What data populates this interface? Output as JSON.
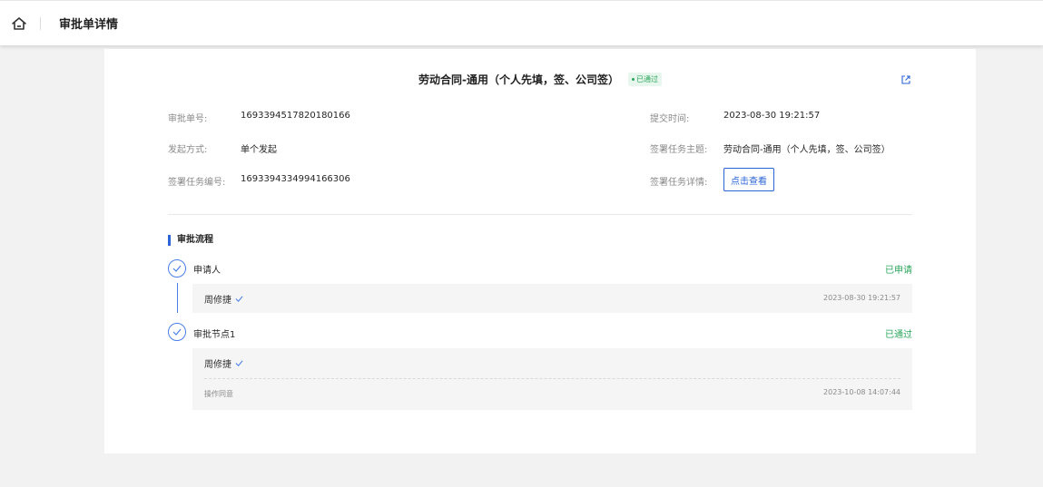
{
  "header": {
    "home_icon": "home-icon",
    "title": "审批单详情"
  },
  "document": {
    "title": "劳动合同-通用（个人先填，签、公司签）",
    "status": "已通过",
    "status_color": "#2aa55b",
    "share_icon": "external-link-icon"
  },
  "info": {
    "approval_no_label": "审批单号:",
    "approval_no": "1693394517820180166",
    "submit_time_label": "提交时间:",
    "submit_time": "2023-08-30 19:21:57",
    "init_method_label": "发起方式:",
    "init_method": "单个发起",
    "sign_topic_label": "签署任务主题:",
    "sign_topic": "劳动合同-通用（个人先填，签、公司签）",
    "sign_task_no_label": "签署任务编号:",
    "sign_task_no": "1693394334994166306",
    "sign_task_detail_label": "签署任务详情:",
    "view_button": "点击查看"
  },
  "flow": {
    "title": "审批流程",
    "accent_color": "#2a64d6",
    "nodes": [
      {
        "name": "申请人",
        "status": "已申请",
        "records": [
          {
            "person": "周修捷",
            "time": "2023-08-30 19:21:57"
          }
        ]
      },
      {
        "name": "审批节点1",
        "status": "已通过",
        "records": [
          {
            "person": "周修捷",
            "action": "操作同意",
            "time": "2023-10-08 14:07:44"
          }
        ]
      }
    ]
  }
}
